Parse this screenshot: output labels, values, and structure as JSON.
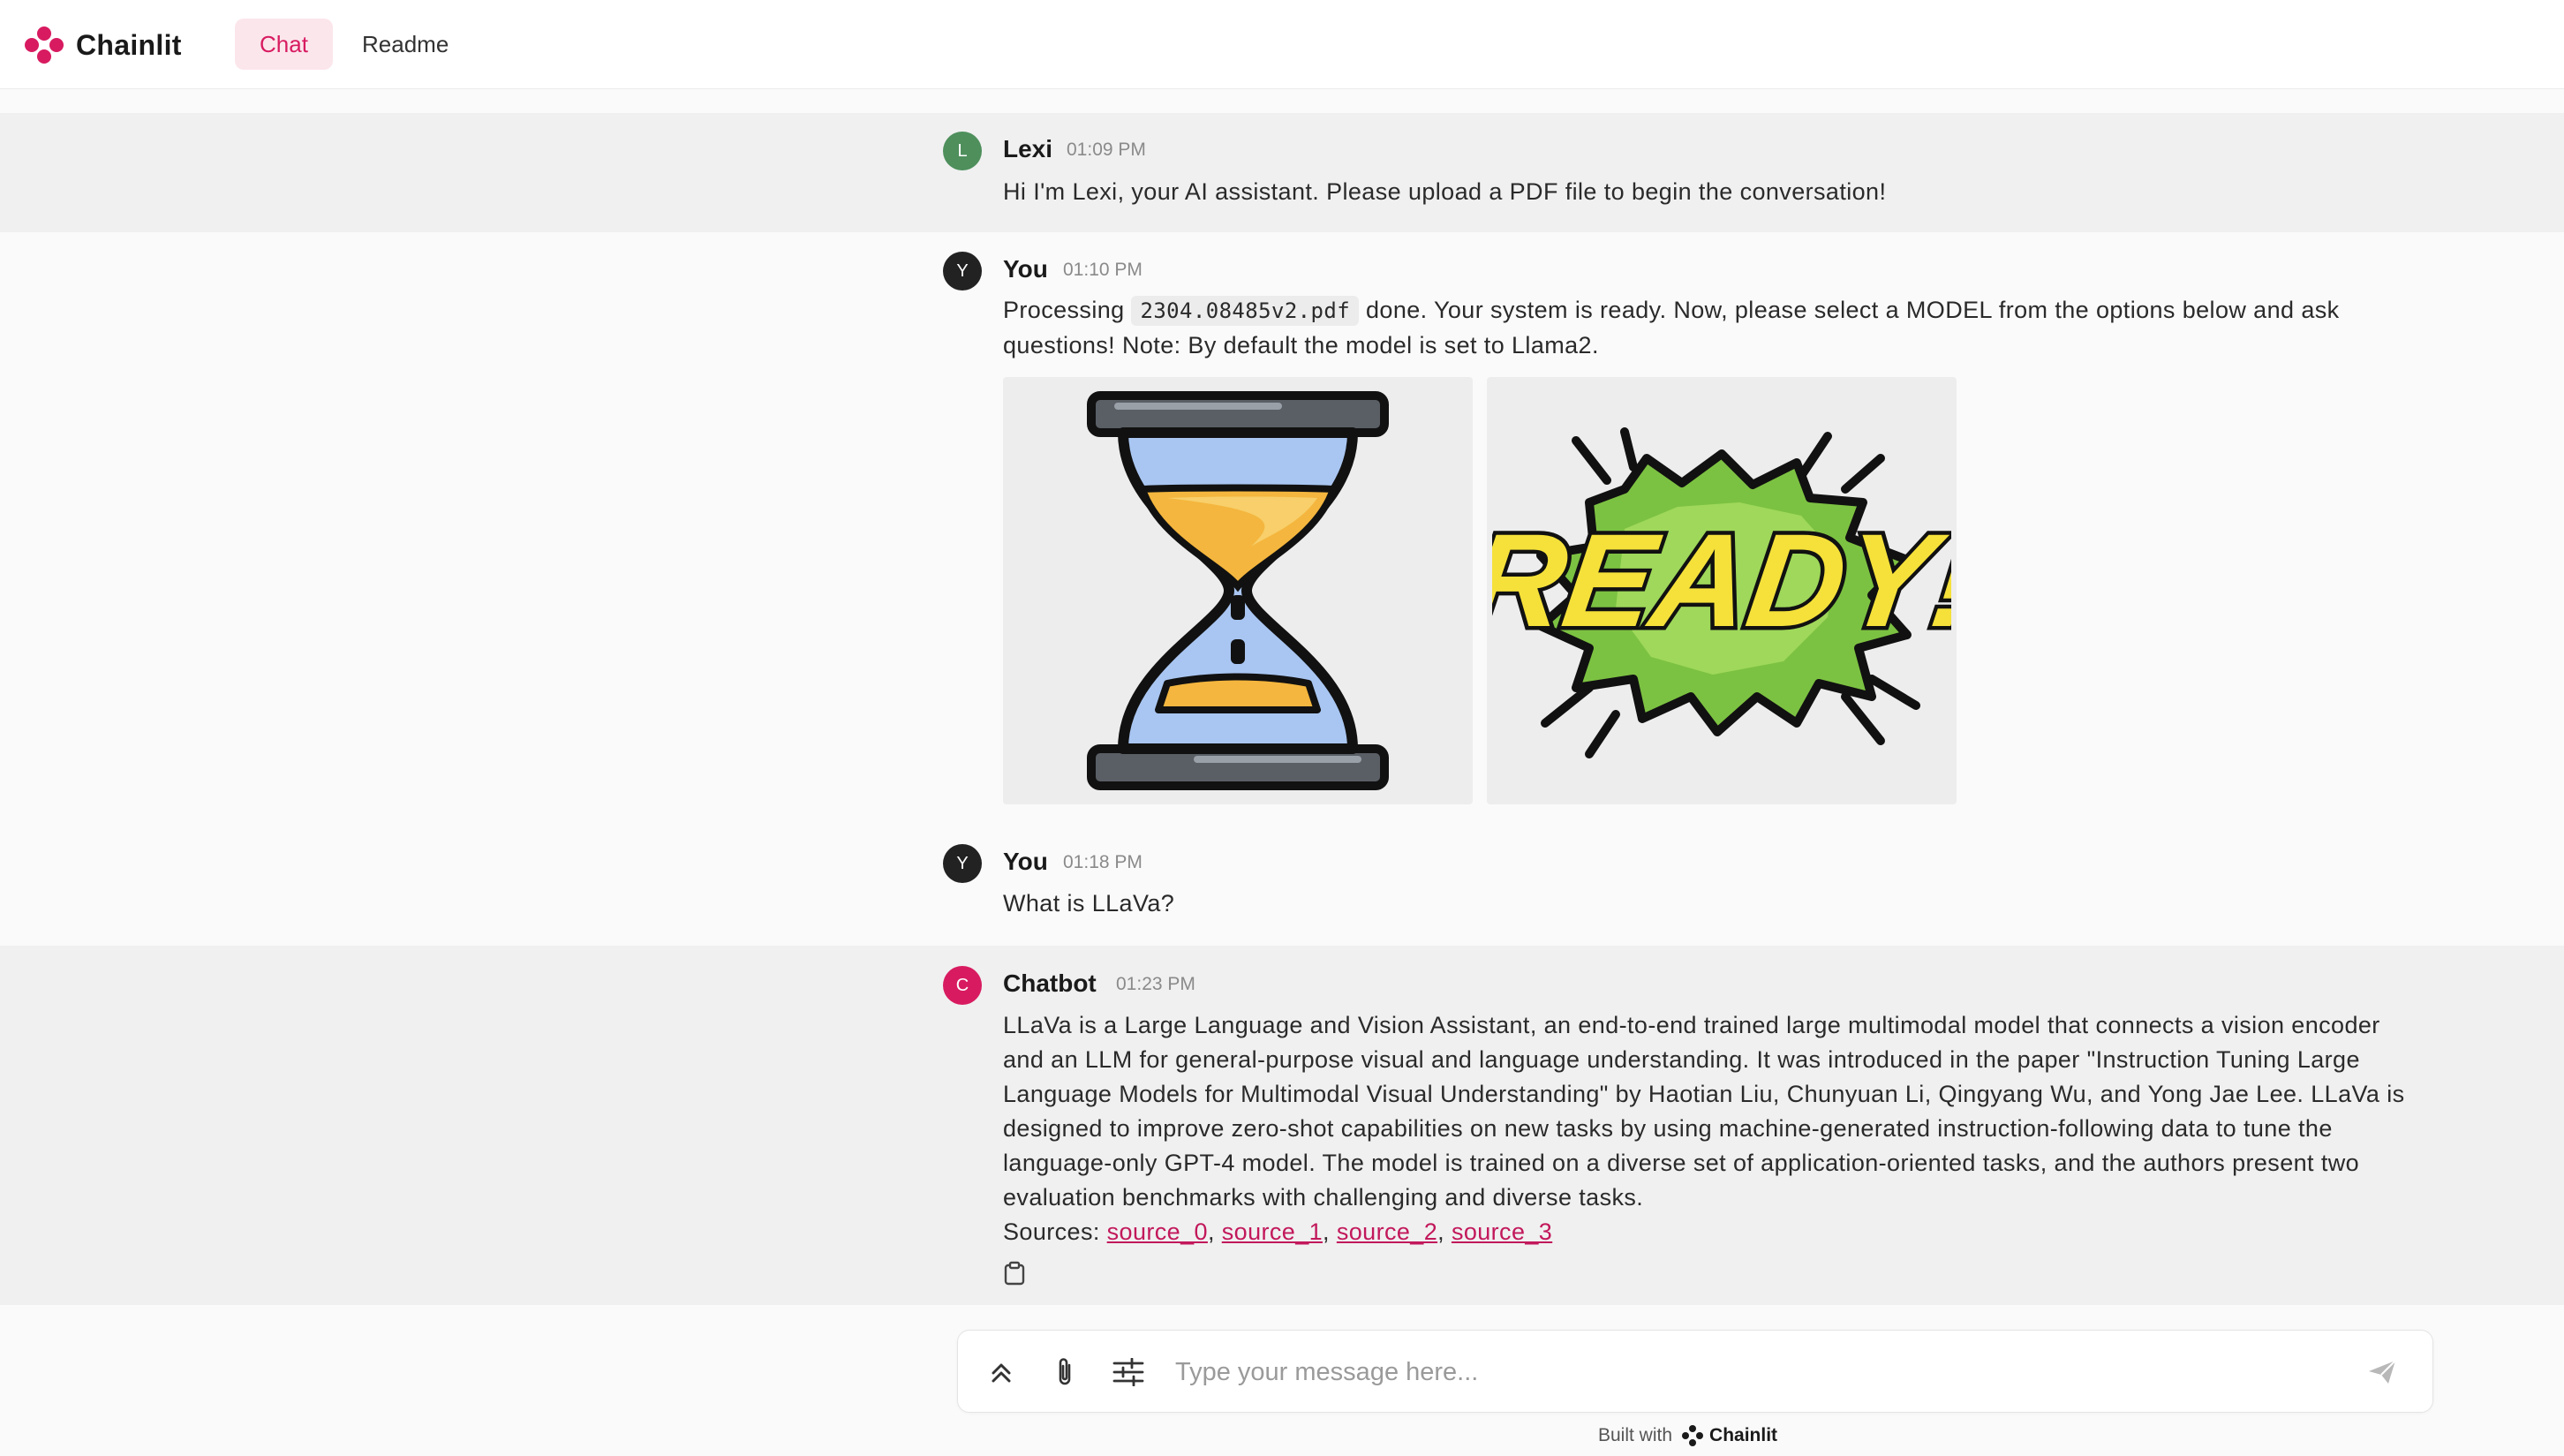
{
  "header": {
    "app_name": "Chainlit",
    "tabs": [
      {
        "label": "Chat",
        "active": true
      },
      {
        "label": "Readme",
        "active": false
      }
    ]
  },
  "messages": [
    {
      "author": "Lexi",
      "avatar_letter": "L",
      "avatar_color": "#4e8f5c",
      "time": "01:09 PM",
      "text": "Hi I'm Lexi, your AI assistant. Please upload a PDF file to begin the conversation!"
    },
    {
      "author": "You",
      "avatar_letter": "Y",
      "avatar_color": "#222222",
      "time": "01:10 PM",
      "text_before": "Processing",
      "filename": "2304.08485v2.pdf",
      "text_after": "done. Your system is ready. Now, please select a MODEL from the options below and ask questions! Note: By default the model is set to Llama2.",
      "images": [
        "hourglass-image",
        "ready-image"
      ],
      "ready_text": "READY!"
    },
    {
      "author": "You",
      "avatar_letter": "Y",
      "avatar_color": "#222222",
      "time": "01:18 PM",
      "text": "What is LLaVa?"
    },
    {
      "author": "Chatbot",
      "avatar_letter": "C",
      "avatar_color": "#d81b60",
      "time": "01:23 PM",
      "text": "LLaVa is a Large Language and Vision Assistant, an end-to-end trained large multimodal model that connects a vision encoder and an LLM for general-purpose visual and language understanding. It was introduced in the paper \"Instruction Tuning Large Language Models for Multimodal Visual Understanding\" by Haotian Liu, Chunyuan Li, Qingyang Wu, and Yong Jae Lee. LLaVa is designed to improve zero-shot capabilities on new tasks by using machine-generated instruction-following data to tune the language-only GPT-4 model. The model is trained on a diverse set of application-oriented tasks, and the authors present two evaluation benchmarks with challenging and diverse tasks.",
      "sources_label": "Sources:",
      "sources": [
        "source_0",
        "source_1",
        "source_2",
        "source_3"
      ]
    }
  ],
  "composer": {
    "placeholder": "Type your message here..."
  },
  "footer": {
    "built_with": "Built with",
    "brand": "Chainlit"
  },
  "colors": {
    "accent": "#d81b60",
    "active_tab_bg": "#fbe6ec"
  }
}
